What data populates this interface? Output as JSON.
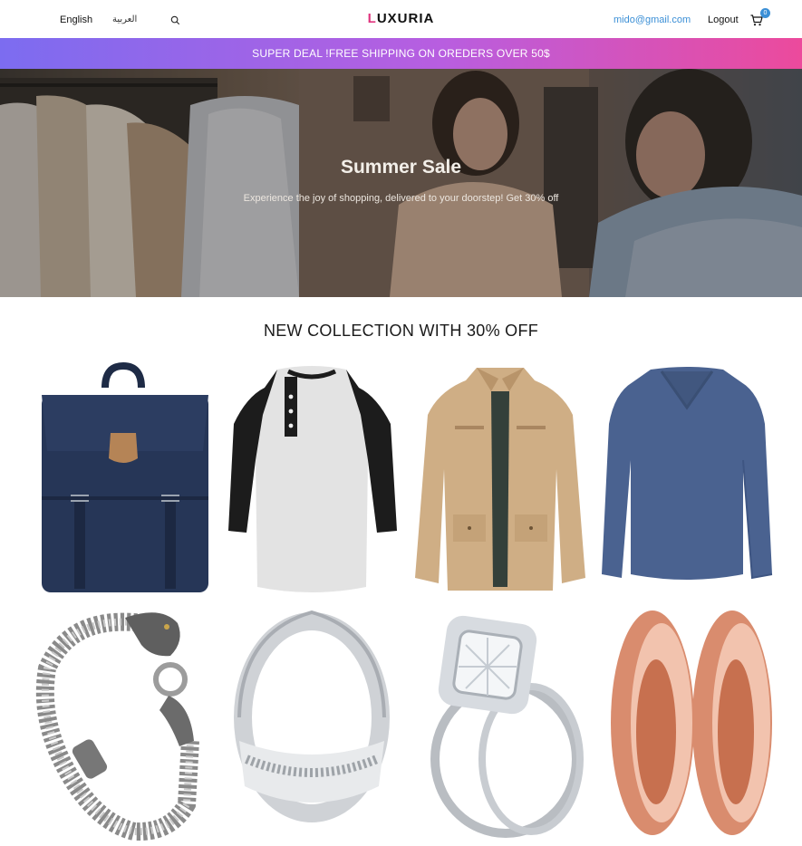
{
  "header": {
    "lang_english": "English",
    "lang_arabic": "العربية",
    "search_icon": "search-icon",
    "logo_first_letter": "L",
    "logo_rest": "UXURIA",
    "email": "mido@gmail.com",
    "logout_label": "Logout",
    "cart_icon": "cart-icon",
    "cart_count": "0"
  },
  "promo": {
    "text": "SUPER DEAL !FREE SHIPPING ON OREDERS OVER 50$"
  },
  "hero": {
    "title": "Summer Sale",
    "subtitle": "Experience the joy of shopping, delivered to your doorstep! Get 30% off"
  },
  "collection": {
    "title": "NEW COLLECTION WITH 30% OFF",
    "products": [
      {
        "image": "navy-backpack"
      },
      {
        "image": "raglan-henley-shirt"
      },
      {
        "image": "beige-field-jacket"
      },
      {
        "image": "blue-vneck-sweater"
      },
      {
        "image": "silver-dragon-bracelet"
      },
      {
        "image": "silver-band-ring"
      },
      {
        "image": "diamond-ring-set"
      },
      {
        "image": "rose-gold-plugs"
      }
    ]
  },
  "colors": {
    "brand_accent": "#e0347e",
    "link_blue": "#3b8fd6",
    "promo_gradient_start": "#7c6cf0",
    "promo_gradient_end": "#ec4a9c"
  }
}
